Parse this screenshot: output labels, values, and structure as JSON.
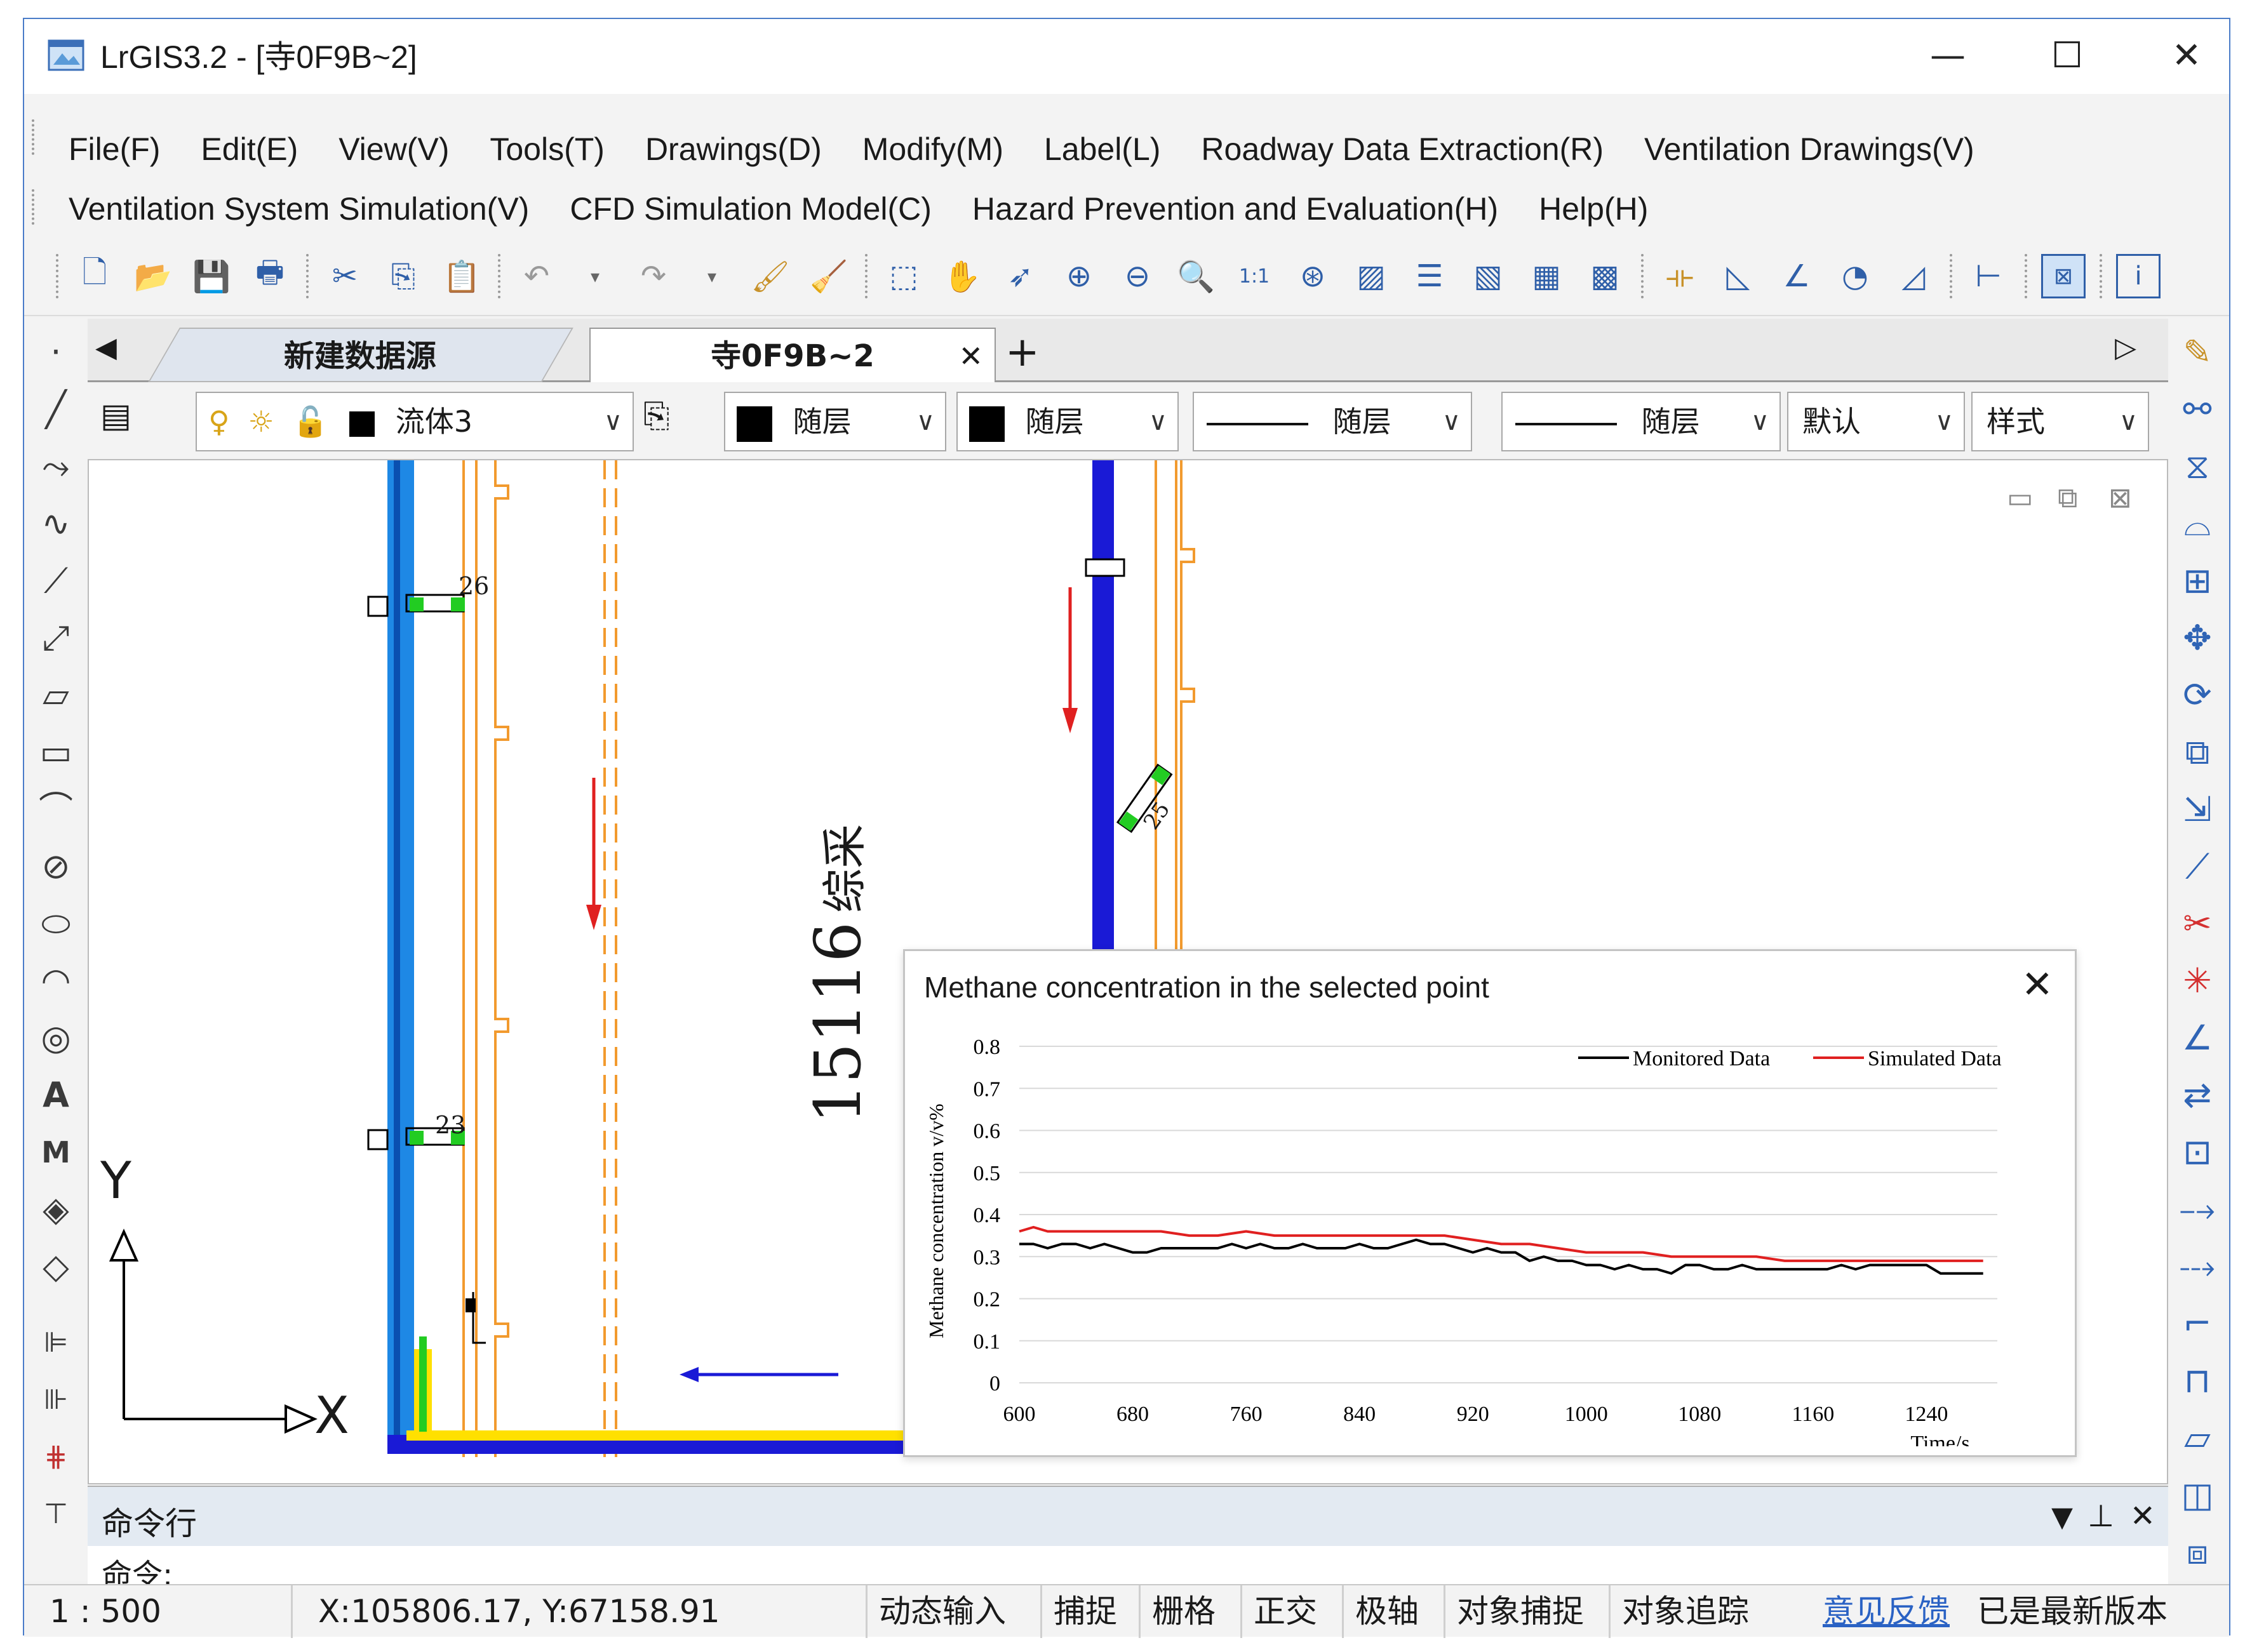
{
  "window": {
    "title": "LrGIS3.2 - [寺0F9B~2]",
    "controls": {
      "minimize": "—",
      "maximize": "☐",
      "close": "✕"
    }
  },
  "menu": {
    "row1": [
      "File(F)",
      "Edit(E)",
      "View(V)",
      "Tools(T)",
      "Drawings(D)",
      "Modify(M)",
      "Label(L)",
      "Roadway Data Extraction(R)",
      "Ventilation Drawings(V)"
    ],
    "row2": [
      "Ventilation System Simulation(V)",
      "CFD Simulation Model(C)",
      "Hazard Prevention and Evaluation(H)",
      "Help(H)"
    ]
  },
  "tabs": {
    "items": [
      {
        "label": "新建数据源",
        "active": false
      },
      {
        "label": "寺0F9B~2",
        "active": true,
        "close": "✕"
      }
    ],
    "new_tab": "+",
    "prev": "◀",
    "next": "▷"
  },
  "properties": {
    "layer_name": "流体3",
    "color1": "随层",
    "color2": "随层",
    "linetype1": "随层",
    "linetype2": "随层",
    "default": "默认",
    "style": "样式"
  },
  "drawing": {
    "face_label": "15116",
    "face_suffix": "综采",
    "dim_26": "26",
    "dim_23": "23",
    "dim_25": "25",
    "axis_y": "Y",
    "axis_x": "X",
    "colors": {
      "airway_left": "#1e88e5",
      "airway_right": "#1a1ad6",
      "orange": "#f29a2e",
      "flow_arrow": "#e02020",
      "marker": "#22cc22"
    }
  },
  "popup": {
    "title": "Methane concentration in the selected point",
    "close": "✕"
  },
  "chart_data": {
    "type": "line",
    "ylabel": "Methane concentration v/v%",
    "xlabel": "Time/s",
    "xlim": [
      600,
      1290
    ],
    "ylim": [
      0,
      0.8
    ],
    "xticks": [
      600,
      680,
      760,
      840,
      920,
      1000,
      1080,
      1160,
      1240
    ],
    "yticks": [
      0,
      0.1,
      0.2,
      0.3,
      0.4,
      0.5,
      0.6,
      0.7,
      0.8
    ],
    "yticklabels": [
      "0",
      "0.1",
      "0.2",
      "0.3",
      "0.4",
      "0.5",
      "0.6",
      "0.7",
      "0.8"
    ],
    "legend_position": "top-right",
    "series": [
      {
        "name": "Monitored Data",
        "color": "#000000",
        "x": [
          600,
          610,
          620,
          630,
          640,
          650,
          660,
          670,
          680,
          690,
          700,
          710,
          720,
          730,
          740,
          750,
          760,
          770,
          780,
          790,
          800,
          810,
          820,
          830,
          840,
          850,
          860,
          870,
          880,
          890,
          900,
          910,
          920,
          930,
          940,
          950,
          960,
          970,
          980,
          990,
          1000,
          1010,
          1020,
          1030,
          1040,
          1050,
          1060,
          1070,
          1080,
          1090,
          1100,
          1110,
          1120,
          1130,
          1140,
          1150,
          1160,
          1170,
          1180,
          1190,
          1200,
          1210,
          1220,
          1230,
          1240,
          1250,
          1260,
          1270,
          1280
        ],
        "y": [
          0.33,
          0.33,
          0.32,
          0.33,
          0.33,
          0.32,
          0.33,
          0.32,
          0.31,
          0.31,
          0.32,
          0.32,
          0.32,
          0.32,
          0.32,
          0.33,
          0.32,
          0.33,
          0.32,
          0.32,
          0.33,
          0.32,
          0.32,
          0.32,
          0.33,
          0.32,
          0.32,
          0.33,
          0.34,
          0.33,
          0.33,
          0.32,
          0.31,
          0.32,
          0.31,
          0.31,
          0.29,
          0.3,
          0.29,
          0.29,
          0.28,
          0.28,
          0.27,
          0.28,
          0.27,
          0.27,
          0.26,
          0.28,
          0.28,
          0.27,
          0.27,
          0.28,
          0.27,
          0.27,
          0.27,
          0.27,
          0.27,
          0.27,
          0.28,
          0.27,
          0.28,
          0.28,
          0.28,
          0.28,
          0.28,
          0.26,
          0.26,
          0.26,
          0.26
        ]
      },
      {
        "name": "Simulated Data",
        "color": "#e02020",
        "x": [
          600,
          610,
          620,
          640,
          660,
          680,
          700,
          720,
          740,
          760,
          780,
          800,
          820,
          840,
          860,
          880,
          900,
          920,
          940,
          960,
          980,
          1000,
          1020,
          1040,
          1060,
          1080,
          1100,
          1120,
          1140,
          1160,
          1180,
          1200,
          1220,
          1240,
          1260,
          1280
        ],
        "y": [
          0.36,
          0.37,
          0.36,
          0.36,
          0.36,
          0.36,
          0.36,
          0.35,
          0.35,
          0.36,
          0.35,
          0.35,
          0.35,
          0.35,
          0.35,
          0.35,
          0.35,
          0.34,
          0.33,
          0.33,
          0.32,
          0.31,
          0.31,
          0.31,
          0.3,
          0.3,
          0.3,
          0.3,
          0.29,
          0.29,
          0.29,
          0.29,
          0.29,
          0.29,
          0.29,
          0.29
        ]
      }
    ]
  },
  "command": {
    "panel_title": "命令行",
    "prompt": "命令:",
    "controls": {
      "dropdown": "▼",
      "pin": "⊥",
      "close": "✕"
    }
  },
  "status": {
    "scale": "1 : 500",
    "coords": "X:105806.17, Y:67158.91",
    "toggles": [
      "动态输入",
      "捕捉",
      "栅格",
      "正交",
      "极轴",
      "对象捕捉",
      "对象追踪"
    ],
    "feedback_link": "意见反馈",
    "version": "已是最新版本"
  }
}
